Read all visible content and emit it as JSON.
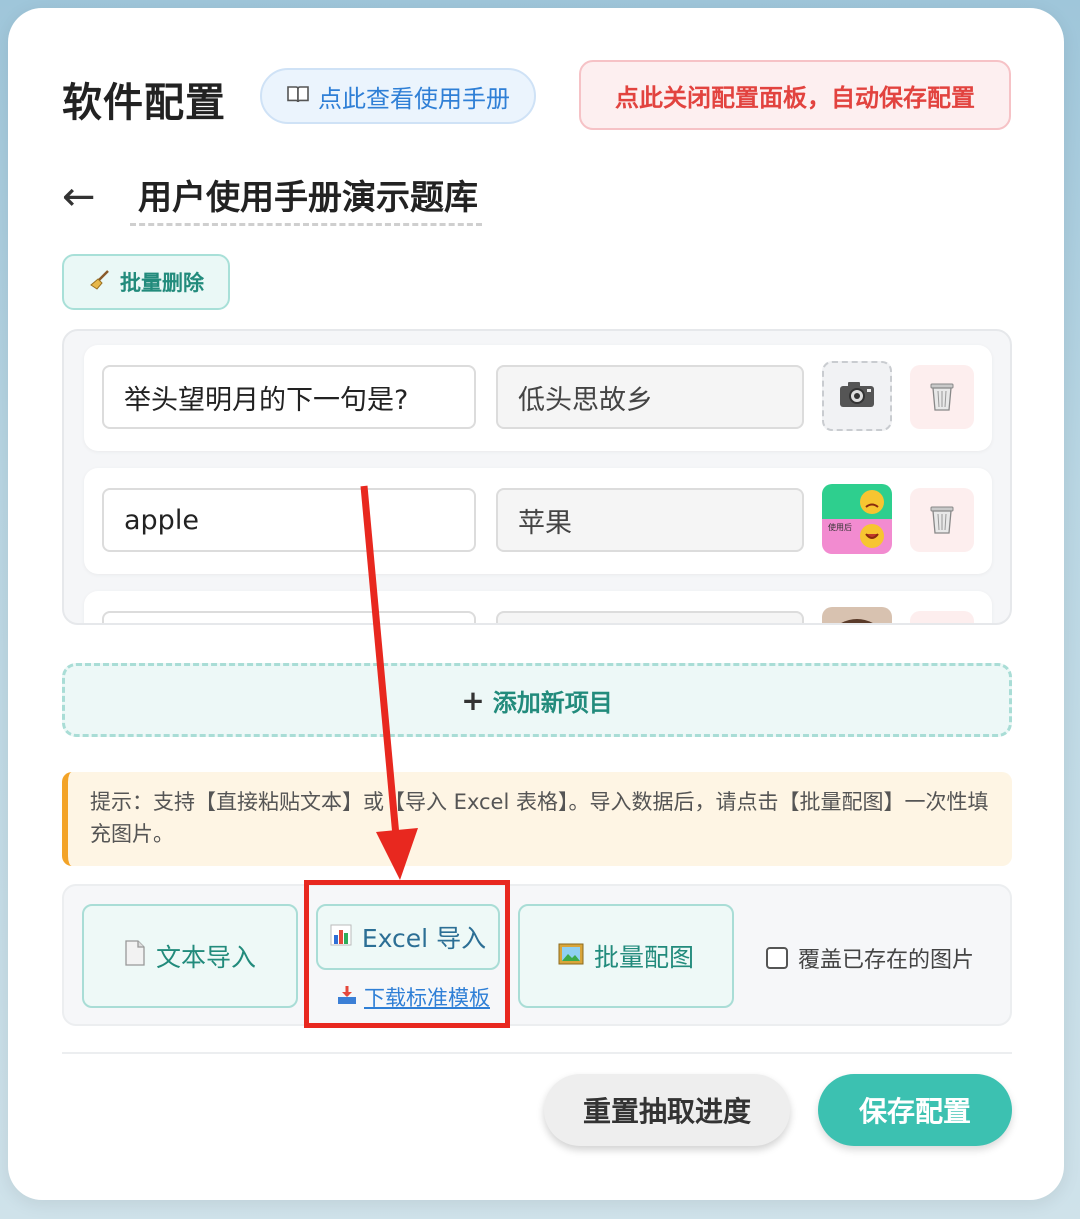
{
  "header": {
    "title": "软件配置",
    "manual_icon": "book-icon",
    "manual_label": "点此查看使用手册",
    "close_label": "点此关闭配置面板，自动保存配置"
  },
  "bank": {
    "back_icon": "back-arrow-icon",
    "back_symbol": "←",
    "title": "用户使用手册演示题库"
  },
  "bulk_delete": {
    "icon": "broom-icon",
    "label": "批量删除"
  },
  "items": [
    {
      "question": "举头望明月的下一句是?",
      "answer": "低头思故乡",
      "image": "camera-placeholder"
    },
    {
      "question": "apple",
      "answer": "苹果",
      "image": "thumbnail-before-after"
    },
    {
      "question": "",
      "answer": "",
      "image": "thumbnail-portrait"
    }
  ],
  "item_tiny_label": "使用后",
  "add_item": {
    "icon": "plus-icon",
    "label": "添加新项目"
  },
  "tip": "提示：支持【直接粘贴文本】或【导入 Excel 表格】。导入数据后，请点击【批量配图】一次性填充图片。",
  "tools": {
    "text_import": {
      "icon": "document-icon",
      "label": "文本导入"
    },
    "excel_import": {
      "icon": "bar-chart-icon",
      "label": "Excel 导入"
    },
    "download_template": {
      "icon": "download-tray-icon",
      "label": "下载标准模板"
    },
    "batch_image": {
      "icon": "picture-icon",
      "label": "批量配图"
    },
    "overwrite_checkbox": {
      "label": "覆盖已存在的图片",
      "checked": false
    }
  },
  "footer": {
    "reset_label": "重置抽取进度",
    "save_label": "保存配置"
  },
  "colors": {
    "teal": "#3cc1b1",
    "teal_text": "#228b7c",
    "red_annotation": "#e8281f",
    "blue_link": "#2f7fd6",
    "tip_accent": "#f3a327"
  }
}
